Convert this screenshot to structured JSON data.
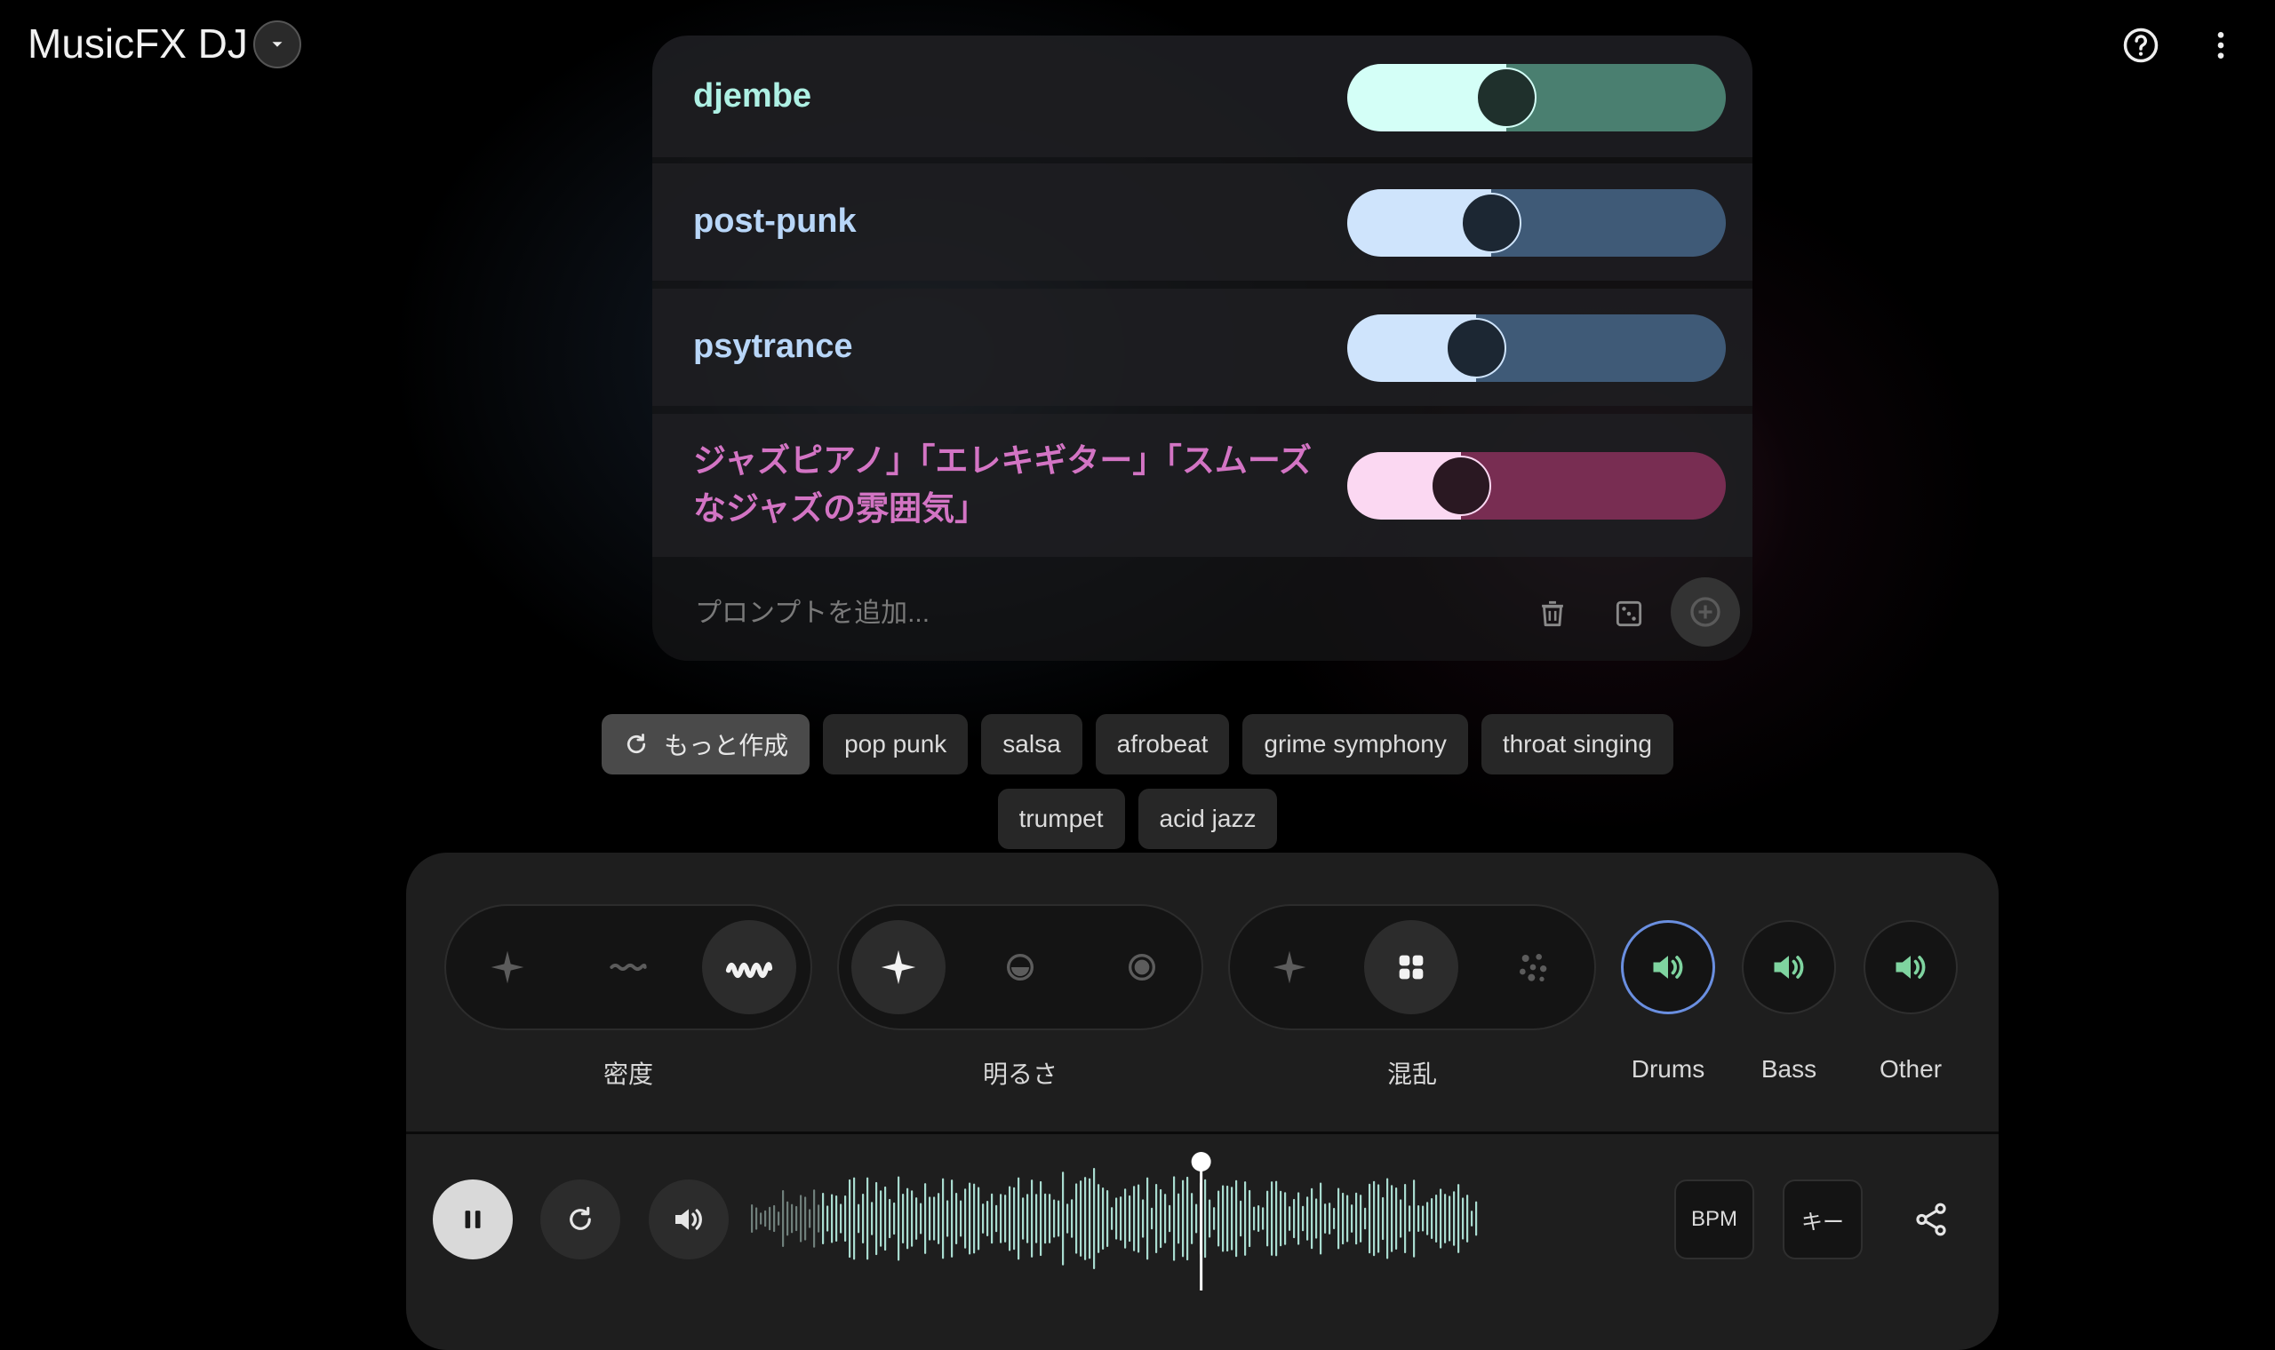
{
  "app": {
    "title": "MusicFX DJ"
  },
  "prompts": [
    {
      "text": "djembe",
      "weight": 0.42,
      "color": "#aef0e4",
      "fill_color": "#d4fff7",
      "track_color": "#4a7f70",
      "thumb_color": "#1f302c"
    },
    {
      "text": "post-punk",
      "weight": 0.38,
      "color": "#b8d6f8",
      "fill_color": "#cfe4fc",
      "track_color": "#3f5a77",
      "thumb_color": "#1c2733"
    },
    {
      "text": "psytrance",
      "weight": 0.34,
      "color": "#b8d6f8",
      "fill_color": "#cfe4fc",
      "track_color": "#3f5a77",
      "thumb_color": "#1c2733"
    },
    {
      "text": "ジャズピアノ」「エレキギター」「スムーズなジャズの雰囲気」",
      "weight": 0.3,
      "color": "#d374c4",
      "fill_color": "#fbd8f2",
      "track_color": "#782d52",
      "thumb_color": "#2a1822"
    }
  ],
  "add_prompt": {
    "placeholder": "プロンプトを追加..."
  },
  "suggestions": {
    "more_label": "もっと作成",
    "chips": [
      "pop punk",
      "salsa",
      "afrobeat",
      "grime symphony",
      "throat singing",
      "trumpet",
      "acid jazz"
    ]
  },
  "controls": {
    "density": {
      "label": "密度",
      "options": [
        "sparkle-icon",
        "wave-low-icon",
        "wave-high-icon"
      ],
      "selected": 2
    },
    "brightness": {
      "label": "明るさ",
      "options": [
        "sparkle-icon",
        "half-circle-icon",
        "dot-circle-icon"
      ],
      "selected": 0
    },
    "chaos": {
      "label": "混乱",
      "options": [
        "sparkle-icon",
        "grid-icon",
        "scatter-icon"
      ],
      "selected": 1
    }
  },
  "stems": [
    {
      "label": "Drums",
      "selected": true
    },
    {
      "label": "Bass",
      "selected": false
    },
    {
      "label": "Other",
      "selected": false
    }
  ],
  "transport": {
    "bpm_label": "BPM",
    "key_label": "キー",
    "playhead_position": 0.62
  },
  "colors": {
    "accent_green": "#7fd4a0",
    "waveform": "#a9dcd0",
    "selected_ring": "#6a8fe0"
  }
}
